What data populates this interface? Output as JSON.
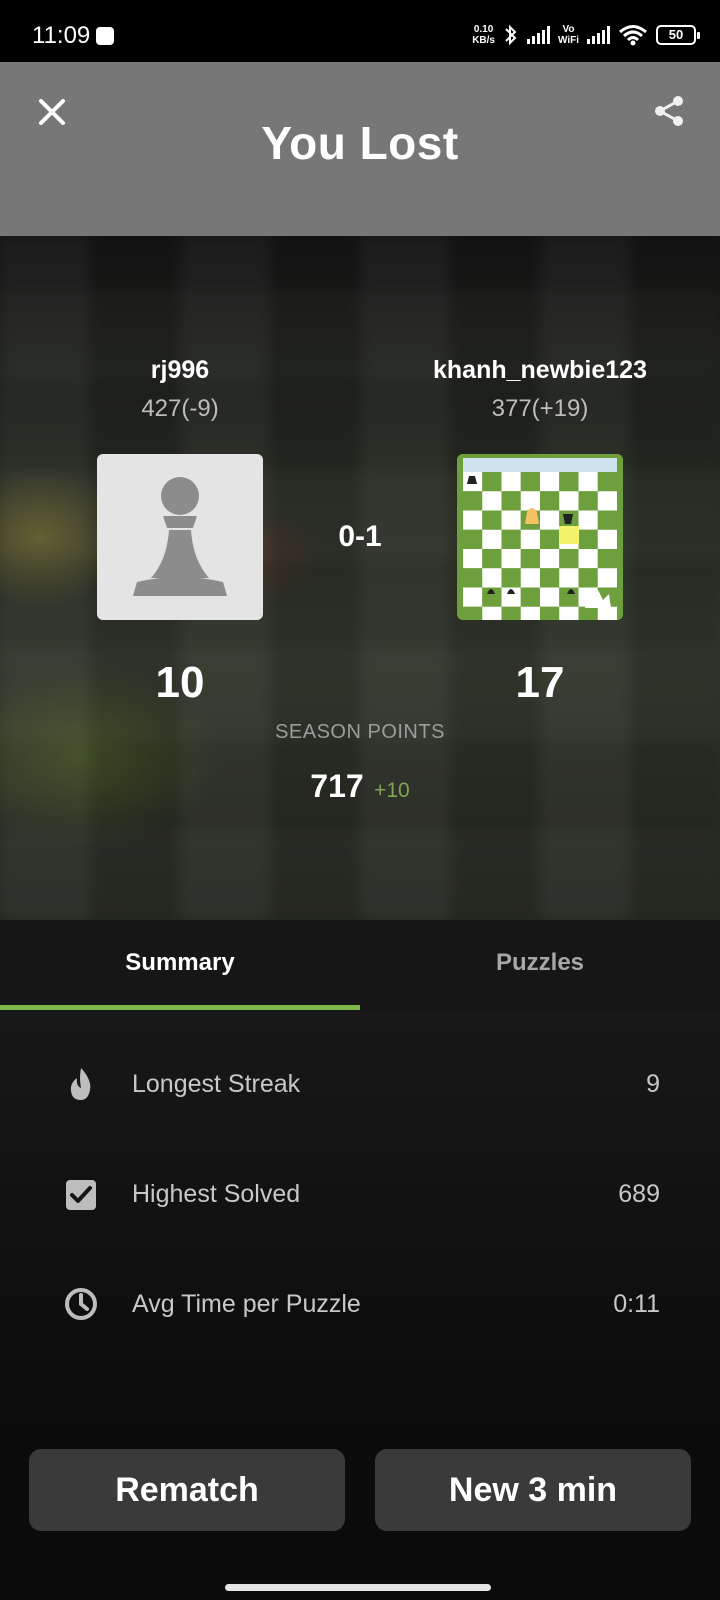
{
  "status_bar": {
    "time": "11:09",
    "speed_top": "0.10",
    "speed_bottom": "KB/s",
    "vo_top": "Vo",
    "vo_bottom": "WiFi",
    "battery": "50"
  },
  "header": {
    "title": "You Lost",
    "close_icon": "close-icon",
    "share_icon": "share-icon"
  },
  "players": {
    "left": {
      "name": "rj996",
      "rating": "427(-9)",
      "points": "10",
      "avatar_icon": "pawn-icon"
    },
    "right": {
      "name": "khanh_newbie123",
      "rating": "377(+19)",
      "points": "17",
      "avatar_icon": "chessboard-avatar-icon",
      "winner_icon": "crown-icon"
    }
  },
  "result": "0-1",
  "season": {
    "label": "SEASON POINTS",
    "total": "717",
    "delta": "+10"
  },
  "tabs": [
    {
      "label": "Summary",
      "active": true
    },
    {
      "label": "Puzzles",
      "active": false
    }
  ],
  "summary": [
    {
      "icon": "flame-icon",
      "label": "Longest Streak",
      "value": "9"
    },
    {
      "icon": "checkbox-icon",
      "label": "Highest Solved",
      "value": "689"
    },
    {
      "icon": "clock-icon",
      "label": "Avg Time per Puzzle",
      "value": "0:11"
    }
  ],
  "buttons": {
    "rematch": "Rematch",
    "new_game": "New 3 min"
  },
  "colors": {
    "header_bg": "#777777",
    "accent_green": "#81b64c",
    "button_bg": "#3a3a3a"
  }
}
